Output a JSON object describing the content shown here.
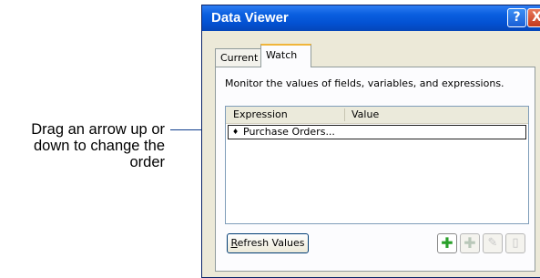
{
  "callout": {
    "line1": "Drag an arrow up or",
    "line2": "down to change the",
    "line3": "order"
  },
  "window": {
    "title": "Data Viewer",
    "help_label": "?",
    "close_label": "X"
  },
  "tabs": [
    {
      "label": "Current",
      "selected": false
    },
    {
      "label": "Watch",
      "selected": true
    }
  ],
  "watch": {
    "description": "Monitor the values of fields, variables, and expressions.",
    "columns": [
      "Expression",
      "Value"
    ],
    "rows": [
      {
        "arrow": "♦",
        "expression": "Purchase Orders...",
        "value": ""
      }
    ],
    "refresh_label_mnemonic": "R",
    "refresh_label_rest": "efresh Values"
  },
  "toolbar": {
    "add_icon": "add-icon",
    "duplicate_icon": "duplicate-icon",
    "edit_icon": "edit-icon",
    "delete_icon": "delete-icon"
  },
  "colors": {
    "titlebar": "#0a5fe0",
    "tab_highlight": "#f0b53a",
    "add_green": "#2aa02a"
  }
}
